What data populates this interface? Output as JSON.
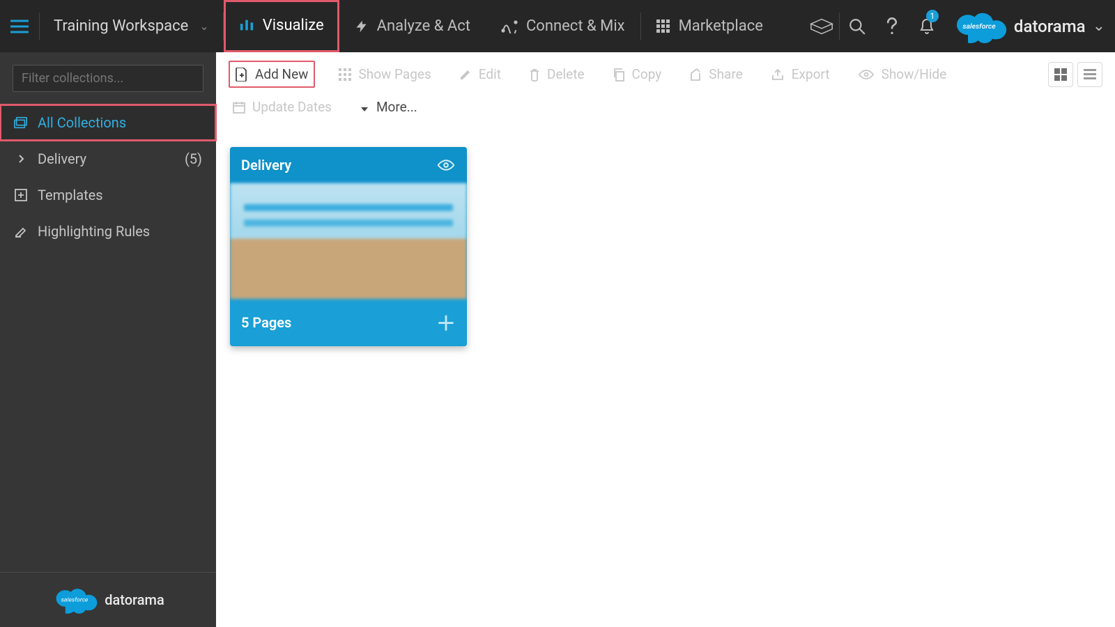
{
  "header": {
    "workspace": "Training Workspace",
    "tabs": {
      "visualize": "Visualize",
      "analyze": "Analyze & Act",
      "connect": "Connect & Mix",
      "marketplace": "Marketplace"
    },
    "notification_count": "1",
    "brand": "datorama"
  },
  "sidebar": {
    "filter_placeholder": "Filter collections...",
    "all_collections": "All Collections",
    "delivery": {
      "label": "Delivery",
      "count": "(5)"
    },
    "templates": "Templates",
    "highlighting": "Highlighting Rules",
    "footer_brand": "datorama"
  },
  "toolbar": {
    "add_new": "Add New",
    "show_pages": "Show Pages",
    "edit": "Edit",
    "delete": "Delete",
    "copy": "Copy",
    "share": "Share",
    "export": "Export",
    "showhide": "Show/Hide",
    "update_dates": "Update Dates",
    "more": "More..."
  },
  "card": {
    "title": "Delivery",
    "footer": "5 Pages"
  }
}
